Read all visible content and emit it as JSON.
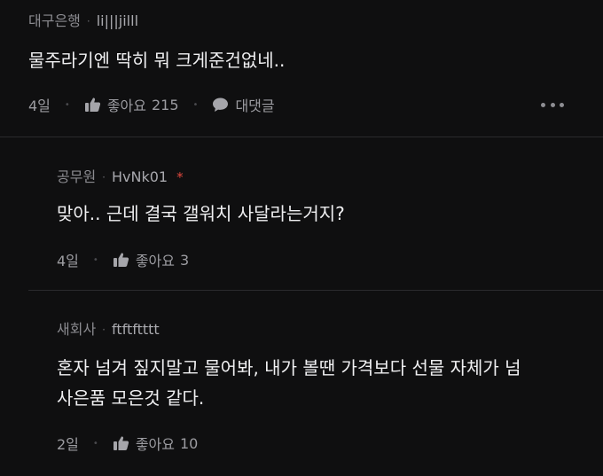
{
  "comments": [
    {
      "company": "대구은행",
      "nickname": "li|||jilll",
      "text": "물주라기엔 딱히 뭐 크게준건없네..",
      "time": "4일",
      "like_label": "좋아요",
      "like_count": "215",
      "reply_label": "대댓글"
    },
    {
      "company": "공무원",
      "nickname": "HvNk01",
      "author_mark": "*",
      "text": "맞아.. 근데 결국 갤워치 사달라는거지?",
      "time": "4일",
      "like_label": "좋아요",
      "like_count": "3"
    },
    {
      "company": "새회사",
      "nickname": "ftftftttt",
      "text_line1": "혼자 넘겨 짚지말고 물어봐, 내가 볼땐 가격보다 선물 자체가 넘",
      "text_line2": "사은품 모은것 같다.",
      "time": "2일",
      "like_label": "좋아요",
      "like_count": "10"
    }
  ],
  "icons": {
    "like": "thumbs-up-icon",
    "reply": "speech-bubble-icon",
    "more": "more-horizontal-icon"
  },
  "colors": {
    "background": "#0f0f10",
    "author_mark": "#e0483d",
    "divider": "#2a2a2d"
  }
}
